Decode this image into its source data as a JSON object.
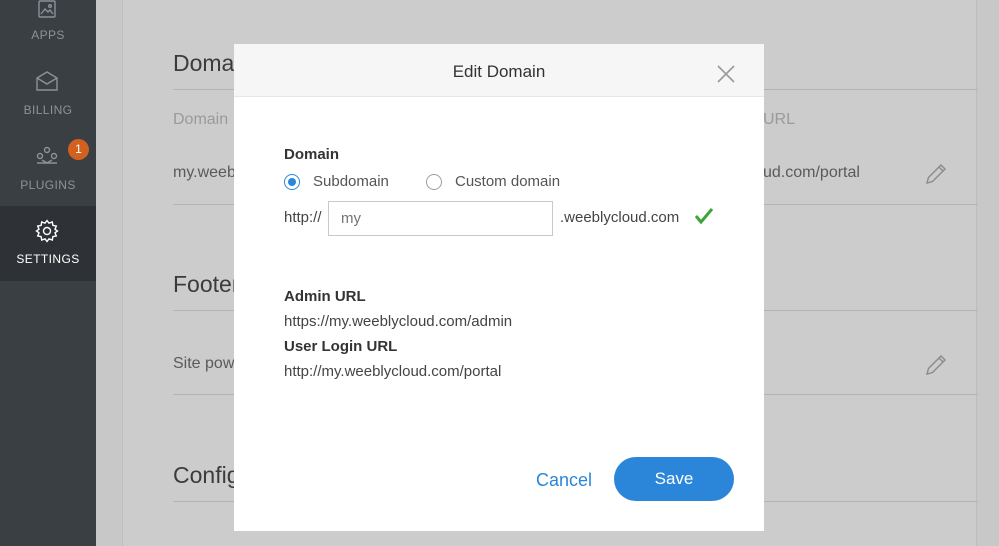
{
  "sidebar": {
    "items": [
      {
        "label": "APPS",
        "icon": "image-icon"
      },
      {
        "label": "BILLING",
        "icon": "envelope-icon"
      },
      {
        "label": "PLUGINS",
        "icon": "plugins-icon",
        "badge": "1"
      },
      {
        "label": "SETTINGS",
        "icon": "gear-icon",
        "active": true
      }
    ]
  },
  "background": {
    "domain_section": {
      "title": "Domain",
      "column_domain": "Domain",
      "column_url": "URL",
      "row_domain": "my.weebl",
      "row_url": "ud.com/portal"
    },
    "footer_section": {
      "title": "Footer M",
      "row_text": "Site powe"
    },
    "config_section": {
      "title": "Configur"
    }
  },
  "modal": {
    "title": "Edit Domain",
    "domain_label": "Domain",
    "options": {
      "subdomain": "Subdomain",
      "custom": "Custom domain",
      "selected": "subdomain"
    },
    "prefix": "http://",
    "subdomain_placeholder": "my",
    "suffix": ".weeblycloud.com",
    "admin_url_label": "Admin URL",
    "admin_url": "https://my.weeblycloud.com/admin",
    "user_login_label": "User Login URL",
    "user_login_url": "http://my.weeblycloud.com/portal",
    "cancel_label": "Cancel",
    "save_label": "Save"
  },
  "colors": {
    "accent": "#2b86d9",
    "success": "#3ea33b",
    "badge": "#d2611f"
  }
}
